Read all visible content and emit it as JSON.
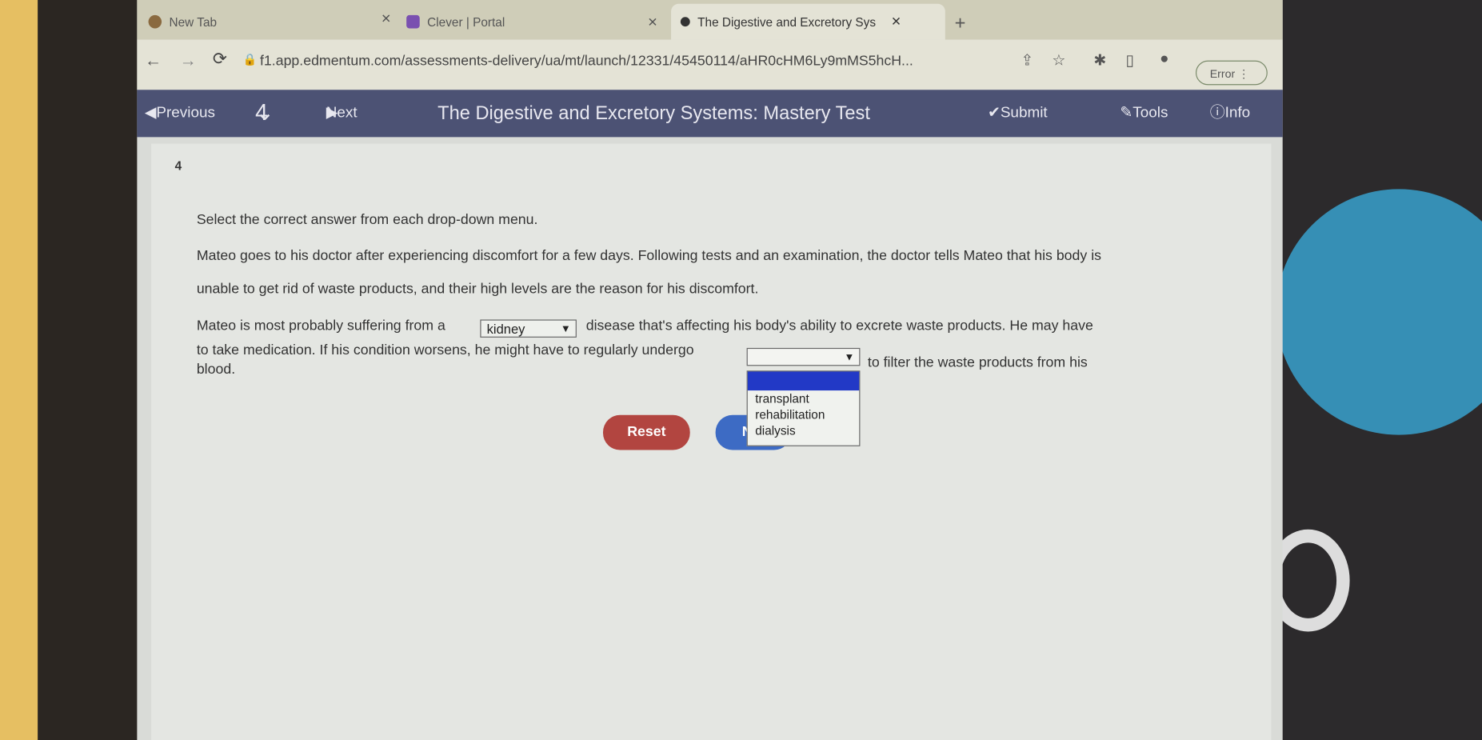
{
  "browser": {
    "tabs": [
      {
        "title": "New Tab",
        "icon": "chrome-icon"
      },
      {
        "title": "Clever | Portal",
        "icon": "clever-icon"
      },
      {
        "title": "The Digestive and Excretory Sys",
        "icon": "edmentum-icon",
        "active": true
      }
    ],
    "new_tab": "+",
    "url": "f1.app.edmentum.com/assessments-delivery/ua/mt/launch/12331/45450114/aHR0cHM6Ly9mMS5hcH...",
    "error_badge": "Error"
  },
  "toolbar": {
    "previous": "Previous",
    "question_number": "4",
    "next": "Next",
    "title": "The Digestive and Excretory Systems: Mastery Test",
    "submit": "Submit Test",
    "tools": "Tools",
    "info": "Info"
  },
  "question": {
    "number": "4",
    "instruction": "Select the correct answer from each drop-down menu.",
    "paragraph_line1": "Mateo goes to his doctor after experiencing discomfort for a few days. Following tests and an examination, the doctor tells Mateo that his body is",
    "paragraph_line2": "unable to get rid of waste products, and their high levels are the reason for his discomfort.",
    "s1_before": "Mateo is most probably suffering from a",
    "dropdown1_value": "kidney",
    "s1_after": "disease that's affecting his body's ability to excrete waste products. He may have",
    "s2_before": "to take medication. If his condition worsens, he might have to regularly undergo",
    "dropdown2_value": "",
    "s2_after": "to filter the waste products from his",
    "s3": "blood.",
    "dropdown2_options": [
      "",
      "transplant",
      "rehabilitation",
      "dialysis"
    ]
  },
  "buttons": {
    "reset": "Reset",
    "next": "N"
  },
  "colors": {
    "navbar": "#4c5274",
    "reset": "#b24540",
    "next": "#3d6bc4",
    "highlight": "#2239c6"
  }
}
